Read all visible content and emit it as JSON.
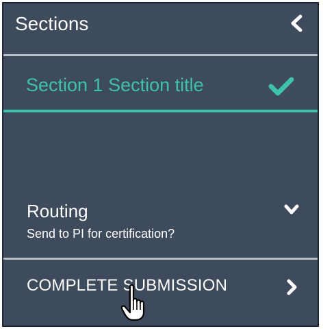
{
  "sidebar": {
    "header": {
      "title": "Sections",
      "collapse_icon": "chevron-left-icon"
    },
    "sections": [
      {
        "label": "Section 1 Section title",
        "status_icon": "checkmark-icon",
        "status": "complete"
      }
    ],
    "routing": {
      "title": "Routing",
      "subtitle": "Send to PI for certification?",
      "toggle_icon": "chevron-down-icon"
    },
    "complete_submission": {
      "label": "COMPLETE SUBMISSION",
      "icon": "chevron-right-icon"
    }
  },
  "colors": {
    "panel_bg": "#3d4b5c",
    "accent": "#3bc3ad",
    "text": "#ffffff",
    "divider": "#b7c0cb"
  },
  "cursor": {
    "icon": "hand-pointer-cursor-icon"
  }
}
